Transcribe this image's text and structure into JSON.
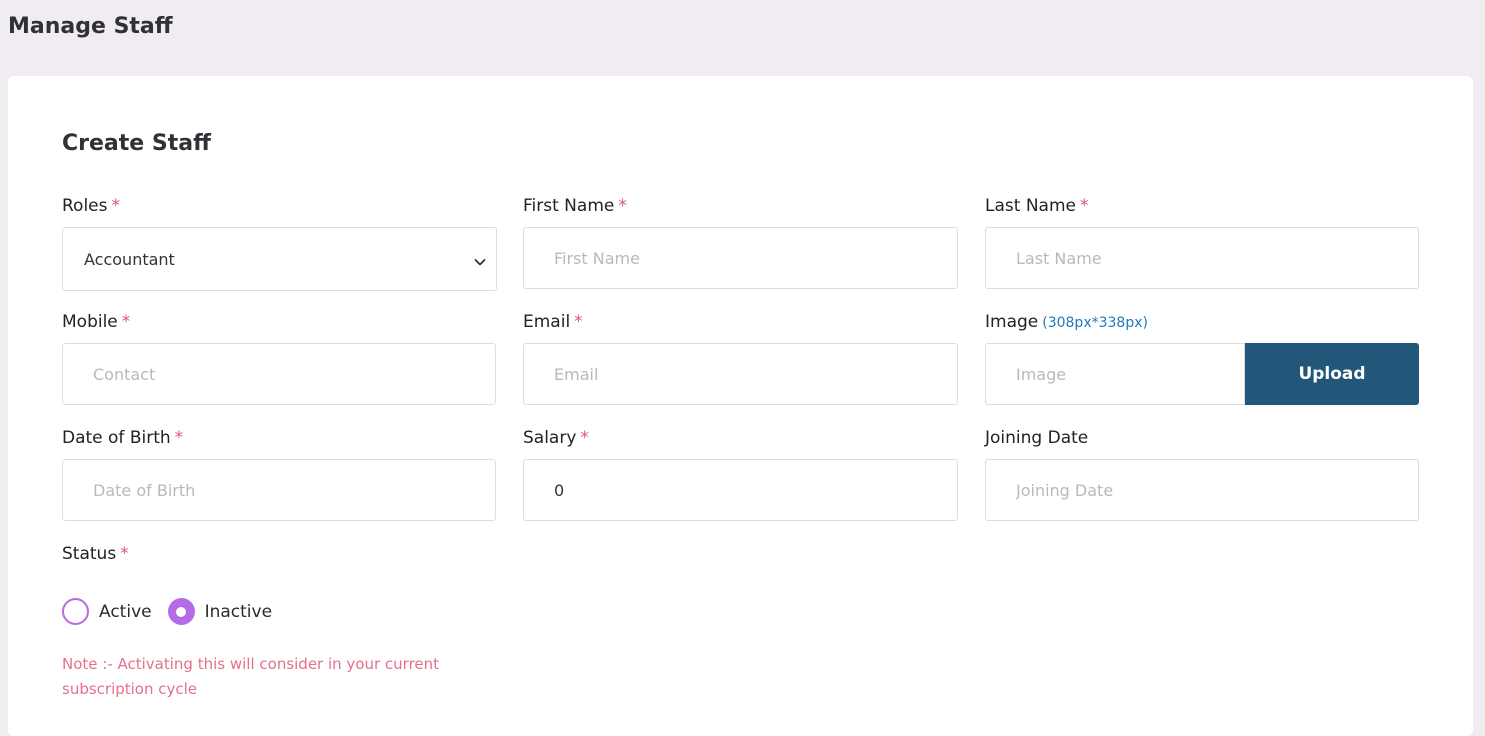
{
  "page": {
    "title": "Manage Staff"
  },
  "form": {
    "title": "Create Staff",
    "required_mark": "*",
    "roles": {
      "label": "Roles",
      "value": "Accountant"
    },
    "first_name": {
      "label": "First Name",
      "placeholder": "First Name",
      "value": ""
    },
    "last_name": {
      "label": "Last Name",
      "placeholder": "Last Name",
      "value": ""
    },
    "mobile": {
      "label": "Mobile",
      "placeholder": "Contact",
      "value": ""
    },
    "email": {
      "label": "Email",
      "placeholder": "Email",
      "value": ""
    },
    "image": {
      "label": "Image",
      "hint": "(308px*338px)",
      "placeholder": "Image",
      "button": "Upload"
    },
    "dob": {
      "label": "Date of Birth",
      "placeholder": "Date of Birth",
      "value": ""
    },
    "salary": {
      "label": "Salary",
      "value": "0"
    },
    "joining_date": {
      "label": "Joining Date",
      "placeholder": "Joining Date",
      "value": ""
    },
    "status": {
      "label": "Status",
      "options": [
        {
          "label": "Active",
          "selected": false
        },
        {
          "label": "Inactive",
          "selected": true
        }
      ]
    },
    "note": "Note :- Activating this will consider in your current subscription cycle"
  },
  "colors": {
    "page_bg": "#f0ecf1",
    "required": "#e0576d",
    "hint": "#1e7ab8",
    "upload_button": "#22577a",
    "radio_accent": "#b66be6",
    "note": "#e57189"
  },
  "icons": {
    "select_arrow": "chevron-down-icon"
  }
}
